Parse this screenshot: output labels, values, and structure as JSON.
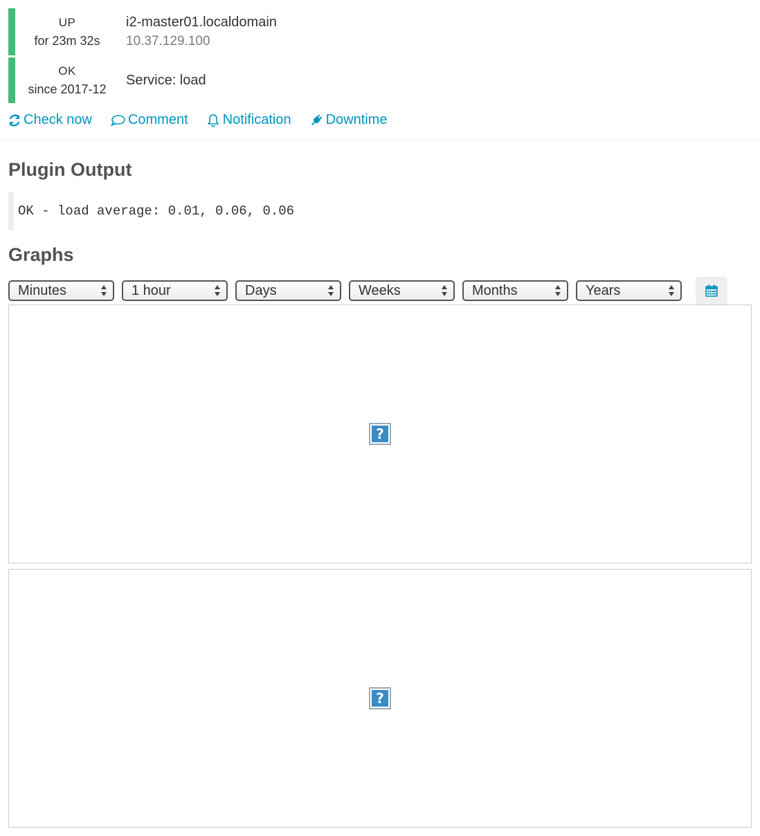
{
  "host": {
    "state": "UP",
    "duration": "for 23m 32s",
    "name": "i2-master01.localdomain",
    "address": "10.37.129.100"
  },
  "service": {
    "state": "OK",
    "since": "since 2017-12",
    "name": "Service: load"
  },
  "actions": {
    "check_now": "Check now",
    "comment": "Comment",
    "notification": "Notification",
    "downtime": "Downtime"
  },
  "plugin_output": {
    "title": "Plugin Output",
    "text": "OK - load average: 0.01, 0.06, 0.06"
  },
  "graphs": {
    "title": "Graphs",
    "selects": [
      "Minutes",
      "1 hour",
      "Days",
      "Weeks",
      "Months",
      "Years"
    ],
    "broken_image_glyph": "?"
  },
  "colors": {
    "ok_green": "#44bb77",
    "link_blue": "#0095bf"
  },
  "icons": {
    "check_now": "refresh-icon",
    "comment": "comment-icon",
    "notification": "bell-icon",
    "downtime": "plug-icon",
    "calendar": "calendar-icon"
  }
}
